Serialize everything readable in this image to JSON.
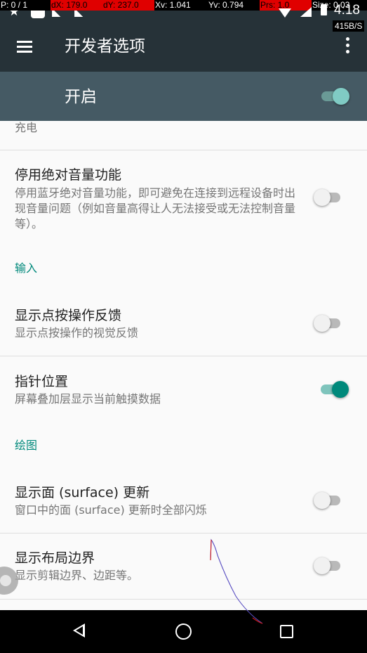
{
  "pointer_location": {
    "p": "P: 0 / 1",
    "dx": "dX: 179.0",
    "dy": "dY: 237.0",
    "xv": "Xv: 1.041",
    "yv": "Yv: 0.794",
    "prs": "Prs: 1.0",
    "size": "Size: 0.03"
  },
  "status_bar": {
    "time": "4:18",
    "net_speed": "415B/S",
    "left_icons": [
      "star-icon",
      "app-square-icon",
      "no-sim-icon",
      "no-sim-icon"
    ],
    "right_icons": [
      "wifi-icon",
      "signal-icon",
      "battery-icon"
    ]
  },
  "app_bar": {
    "title": "开发者选项",
    "menu_icon": "hamburger-menu-icon",
    "overflow_icon": "more-vert-icon"
  },
  "master_switch": {
    "label": "开启",
    "checked": true
  },
  "partial_top": {
    "summary_tail": "充电"
  },
  "settings": [
    {
      "title": "停用绝对音量功能",
      "summary": "停用蓝牙绝对音量功能，即可避免在连接到远程设备时出现音量问题（例如音量高得让人无法接受或无法控制音量等）。",
      "checked": false
    },
    {
      "category": "输入"
    },
    {
      "title": "显示点按操作反馈",
      "summary": "显示点按操作的视觉反馈",
      "checked": false
    },
    {
      "title": "指针位置",
      "summary": "屏幕叠加层显示当前触摸数据",
      "checked": true
    },
    {
      "category": "绘图"
    },
    {
      "title": "显示面 (surface) 更新",
      "summary": "窗口中的面 (surface) 更新时全部闪烁",
      "checked": false
    },
    {
      "title": "显示布局边界",
      "summary": "显示剪辑边界、边距等。",
      "checked": false
    }
  ],
  "nav_bar": {
    "back_icon": "back-triangle-icon",
    "home_icon": "home-circle-icon",
    "recents_icon": "recents-square-icon"
  },
  "colors": {
    "app_bar": "#263238",
    "master_bar": "#455a64",
    "accent": "#00897b",
    "background": "#fafafa"
  }
}
